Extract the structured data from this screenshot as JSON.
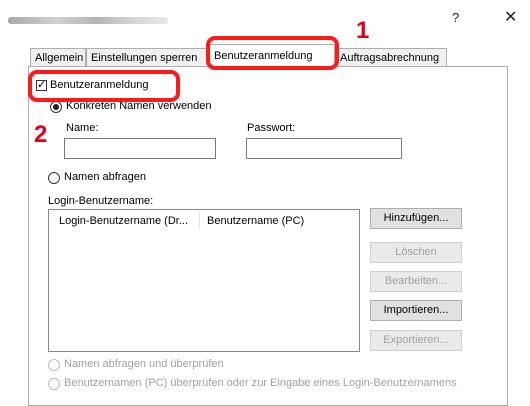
{
  "window": {
    "help_label": "?",
    "close_label": "✕"
  },
  "tabs": [
    {
      "label": "Allgemein",
      "active": false
    },
    {
      "label": "Einstellungen sperren",
      "active": false
    },
    {
      "label": "Benutzeranmeldung",
      "active": true
    },
    {
      "label": "Auftragsabrechnung",
      "active": false
    }
  ],
  "callouts": {
    "step1": "1",
    "step2": "2"
  },
  "user_login": {
    "checkbox_label": "Benutzeranmeldung",
    "checked": true,
    "radio_use_specific": "Konkreten Namen verwenden",
    "name_label": "Name:",
    "name_value": "",
    "password_label": "Passwort:",
    "password_value": "",
    "radio_prompt": "Namen abfragen"
  },
  "login_usernames": {
    "group_label": "Login-Benutzername:",
    "columns": [
      "Login-Benutzername (Dr...",
      "Benutzername (PC)"
    ],
    "rows": []
  },
  "buttons": {
    "add": "Hinzufügen...",
    "delete": "Löschen",
    "edit": "Bearbeiten...",
    "import": "Importieren...",
    "export": "Exportieren..."
  },
  "bottom_options": {
    "prompt_and_check": "Namen abfragen und überprüfen",
    "check_pc_name": "Benutzernamen (PC) überprüfen oder zur Eingabe eines Login-Benutzernamens"
  },
  "colors": {
    "highlight": "#ff1a1a",
    "callout_number": "#e2001a"
  }
}
